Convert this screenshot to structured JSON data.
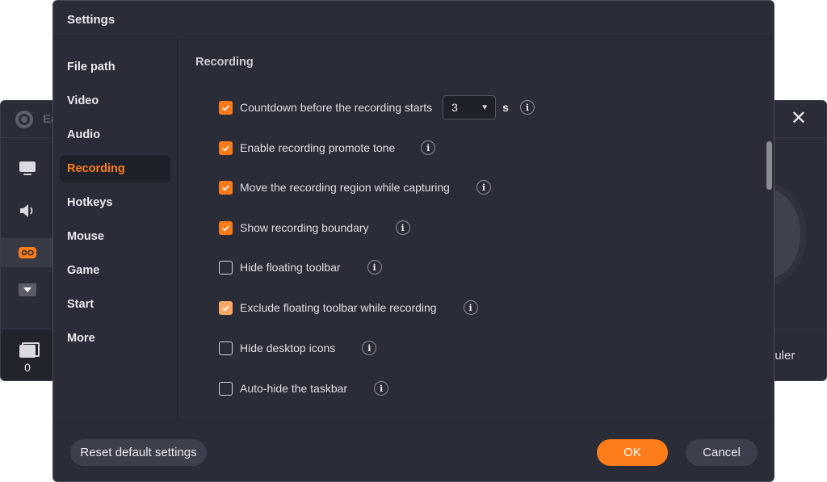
{
  "background_app": {
    "title_partial": "Ea",
    "sidebar_icons": [
      "monitor-icon",
      "speaker-icon",
      "gamepad-icon",
      "dropdown-icon"
    ],
    "file_count": "0",
    "scheduler_partial": "duler",
    "close_icon": "close-icon"
  },
  "dialog": {
    "title": "Settings",
    "nav": [
      {
        "label": "File path",
        "active": false
      },
      {
        "label": "Video",
        "active": false
      },
      {
        "label": "Audio",
        "active": false
      },
      {
        "label": "Recording",
        "active": true
      },
      {
        "label": "Hotkeys",
        "active": false
      },
      {
        "label": "Mouse",
        "active": false
      },
      {
        "label": "Game",
        "active": false
      },
      {
        "label": "Start",
        "active": false
      },
      {
        "label": "More",
        "active": false
      }
    ],
    "section_title": "Recording",
    "options": [
      {
        "label": "Countdown before the recording starts",
        "checked": true
      },
      {
        "label": "Enable recording promote tone",
        "checked": true
      },
      {
        "label": "Move the recording region while capturing",
        "checked": true
      },
      {
        "label": "Show recording boundary",
        "checked": true
      },
      {
        "label": "Hide floating toolbar",
        "checked": false
      },
      {
        "label": "Exclude floating toolbar while recording",
        "checked": true,
        "disabled": true
      },
      {
        "label": "Hide desktop icons",
        "checked": false
      },
      {
        "label": "Auto-hide the taskbar",
        "checked": false
      }
    ],
    "countdown": {
      "value": "3",
      "unit": "s"
    },
    "info_glyph": "i",
    "footer": {
      "reset_label": "Reset default settings",
      "ok_label": "OK",
      "cancel_label": "Cancel"
    }
  },
  "colors": {
    "accent": "#ff7c1a",
    "background": "#2a2c38",
    "nav_active_bg": "#1f212a"
  }
}
